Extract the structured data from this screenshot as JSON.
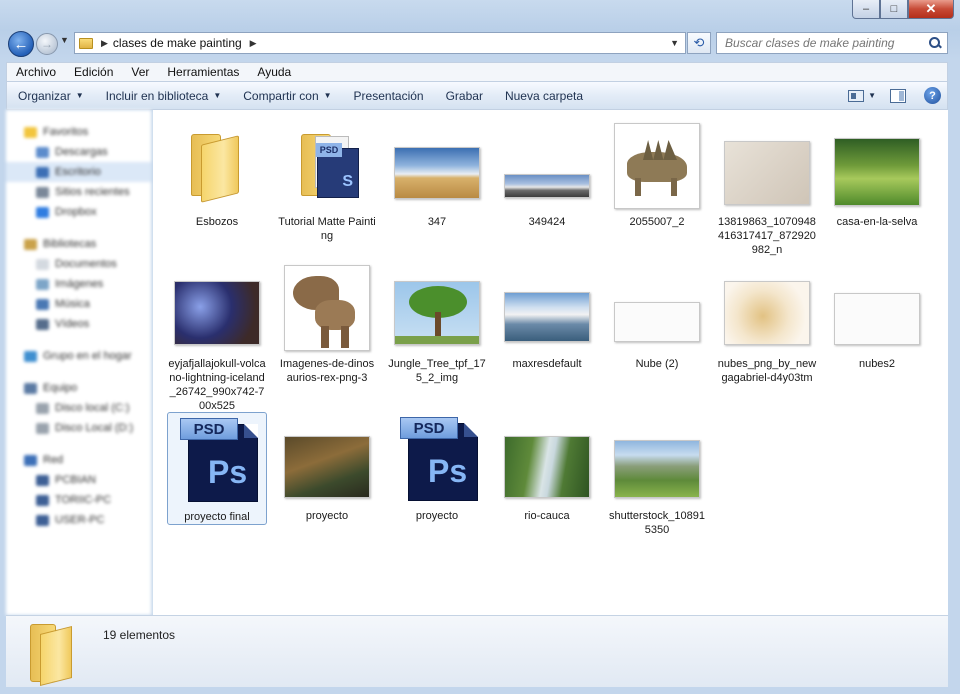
{
  "window": {
    "caption_min": "–",
    "caption_max": "□",
    "caption_close": "✕"
  },
  "address": {
    "path": "clases de make painting",
    "search_placeholder": "Buscar clases de make painting"
  },
  "menu": [
    "Archivo",
    "Edición",
    "Ver",
    "Herramientas",
    "Ayuda"
  ],
  "toolbar": {
    "organize": "Organizar",
    "include": "Incluir en biblioteca",
    "share": "Compartir con",
    "slideshow": "Presentación",
    "burn": "Grabar",
    "new_folder": "Nueva carpeta"
  },
  "nav": {
    "favorites": "Favoritos",
    "downloads": "Descargas",
    "desktop": "Escritorio",
    "recent": "Sitios recientes",
    "dropbox": "Dropbox",
    "libraries": "Bibliotecas",
    "documents": "Documentos",
    "images": "Imágenes",
    "music": "Música",
    "videos": "Vídeos",
    "homegroup": "Grupo en el hogar",
    "computer": "Equipo",
    "disk_c": "Disco local (C:)",
    "disk_d": "Disco Local (D:)",
    "network": "Red",
    "pc1": "PCBIAN",
    "pc2": "TORIIC-PC",
    "pc3": "USER-PC"
  },
  "files": [
    {
      "name": "Esbozos",
      "kind": "folder"
    },
    {
      "name": "Tutorial Matte Painting",
      "kind": "folder-psd"
    },
    {
      "name": "347",
      "kind": "image"
    },
    {
      "name": "349424",
      "kind": "image"
    },
    {
      "name": "2055007_2",
      "kind": "image"
    },
    {
      "name": "13819863_1070948416317417_872920982_n",
      "kind": "image"
    },
    {
      "name": "casa-en-la-selva",
      "kind": "image"
    },
    {
      "name": "eyjafjallajokull-volcano-lightning-iceland_26742_990x742-700x525",
      "kind": "image"
    },
    {
      "name": "Imagenes-de-dinosaurios-rex-png-3",
      "kind": "image"
    },
    {
      "name": "Jungle_Tree_tpf_175_2_img",
      "kind": "image"
    },
    {
      "name": "maxresdefault",
      "kind": "image"
    },
    {
      "name": "Nube (2)",
      "kind": "image"
    },
    {
      "name": "nubes_png_by_newgagabriel-d4y03tm",
      "kind": "image"
    },
    {
      "name": "nubes2",
      "kind": "image"
    },
    {
      "name": "proyecto final",
      "kind": "psd"
    },
    {
      "name": "proyecto",
      "kind": "image"
    },
    {
      "name": "proyecto",
      "kind": "psd"
    },
    {
      "name": "rio-cauca",
      "kind": "image"
    },
    {
      "name": "shutterstock_108915350",
      "kind": "image"
    }
  ],
  "psd_tab": "PSD",
  "psd_mark": "Ps",
  "psd_mini_mark": "S",
  "status": {
    "count": "19 elementos"
  }
}
